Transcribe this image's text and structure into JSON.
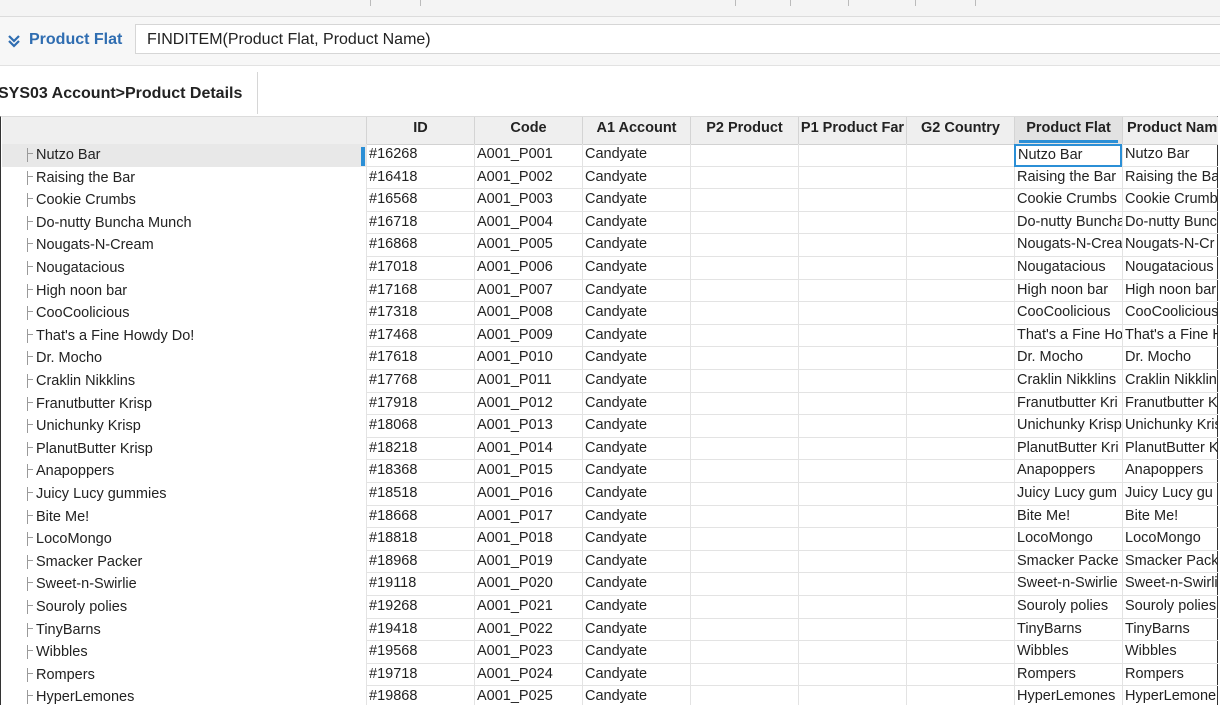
{
  "formula_bar": {
    "name": "Product Flat",
    "formula": "FINDITEM(Product Flat, Product Name)",
    "chevron_icon": "double-chevron-down-icon"
  },
  "view": {
    "title": "SYS03 Account>Product Details"
  },
  "colors": {
    "accent": "#2b8fd6",
    "name_blue": "#2f6db1",
    "header_bg": "#efefef",
    "selected_row": "#e8e8e8"
  },
  "grid": {
    "columns": [
      {
        "key": "id",
        "label": "ID"
      },
      {
        "key": "code",
        "label": "Code"
      },
      {
        "key": "a1",
        "label": "A1 Account"
      },
      {
        "key": "p2",
        "label": "P2 Product"
      },
      {
        "key": "p1",
        "label": "P1 Product Far"
      },
      {
        "key": "g2",
        "label": "G2 Country"
      },
      {
        "key": "flat",
        "label": "Product Flat"
      },
      {
        "key": "name",
        "label": "Product Nam"
      }
    ],
    "active_column": "Product Flat",
    "selected_row": 0,
    "rows": [
      {
        "item": "Nutzo Bar",
        "id": "#16268",
        "code": "A001_P001",
        "a1": "Candyate",
        "p2": "",
        "p1": "",
        "g2": "",
        "flat": "Nutzo Bar",
        "name": "Nutzo Bar"
      },
      {
        "item": "Raising the Bar",
        "id": "#16418",
        "code": "A001_P002",
        "a1": "Candyate",
        "p2": "",
        "p1": "",
        "g2": "",
        "flat": "Raising the Bar",
        "name": "Raising the Ba"
      },
      {
        "item": "Cookie Crumbs",
        "id": "#16568",
        "code": "A001_P003",
        "a1": "Candyate",
        "p2": "",
        "p1": "",
        "g2": "",
        "flat": "Cookie Crumbs",
        "name": "Cookie Crumb"
      },
      {
        "item": "Do-nutty Buncha Munch",
        "id": "#16718",
        "code": "A001_P004",
        "a1": "Candyate",
        "p2": "",
        "p1": "",
        "g2": "",
        "flat": "Do-nutty Buncha",
        "name": "Do-nutty Bunc"
      },
      {
        "item": "Nougats-N-Cream",
        "id": "#16868",
        "code": "A001_P005",
        "a1": "Candyate",
        "p2": "",
        "p1": "",
        "g2": "",
        "flat": "Nougats-N-Crea",
        "name": "Nougats-N-Cr"
      },
      {
        "item": "Nougatacious",
        "id": "#17018",
        "code": "A001_P006",
        "a1": "Candyate",
        "p2": "",
        "p1": "",
        "g2": "",
        "flat": "Nougatacious",
        "name": "Nougatacious"
      },
      {
        "item": "High noon bar",
        "id": "#17168",
        "code": "A001_P007",
        "a1": "Candyate",
        "p2": "",
        "p1": "",
        "g2": "",
        "flat": "High noon bar",
        "name": "High noon bar"
      },
      {
        "item": "CooCoolicious",
        "id": "#17318",
        "code": "A001_P008",
        "a1": "Candyate",
        "p2": "",
        "p1": "",
        "g2": "",
        "flat": "CooCoolicious",
        "name": "CooCoolicious"
      },
      {
        "item": "That's a Fine Howdy Do!",
        "id": "#17468",
        "code": "A001_P009",
        "a1": "Candyate",
        "p2": "",
        "p1": "",
        "g2": "",
        "flat": "That's a Fine Ho",
        "name": "That's a Fine H"
      },
      {
        "item": "Dr. Mocho",
        "id": "#17618",
        "code": "A001_P010",
        "a1": "Candyate",
        "p2": "",
        "p1": "",
        "g2": "",
        "flat": "Dr. Mocho",
        "name": "Dr. Mocho"
      },
      {
        "item": "Craklin Nikklins",
        "id": "#17768",
        "code": "A001_P011",
        "a1": "Candyate",
        "p2": "",
        "p1": "",
        "g2": "",
        "flat": "Craklin Nikklins",
        "name": "Craklin Nikklin"
      },
      {
        "item": "Franutbutter Krisp",
        "id": "#17918",
        "code": "A001_P012",
        "a1": "Candyate",
        "p2": "",
        "p1": "",
        "g2": "",
        "flat": "Franutbutter Kri",
        "name": "Franutbutter K"
      },
      {
        "item": "Unichunky Krisp",
        "id": "#18068",
        "code": "A001_P013",
        "a1": "Candyate",
        "p2": "",
        "p1": "",
        "g2": "",
        "flat": "Unichunky Krisp",
        "name": "Unichunky Kris"
      },
      {
        "item": "PlanutButter Krisp",
        "id": "#18218",
        "code": "A001_P014",
        "a1": "Candyate",
        "p2": "",
        "p1": "",
        "g2": "",
        "flat": "PlanutButter Kri",
        "name": "PlanutButter K"
      },
      {
        "item": "Anapoppers",
        "id": "#18368",
        "code": "A001_P015",
        "a1": "Candyate",
        "p2": "",
        "p1": "",
        "g2": "",
        "flat": "Anapoppers",
        "name": "Anapoppers"
      },
      {
        "item": "Juicy Lucy gummies",
        "id": "#18518",
        "code": "A001_P016",
        "a1": "Candyate",
        "p2": "",
        "p1": "",
        "g2": "",
        "flat": "Juicy Lucy gum",
        "name": "Juicy Lucy gu"
      },
      {
        "item": "Bite Me!",
        "id": "#18668",
        "code": "A001_P017",
        "a1": "Candyate",
        "p2": "",
        "p1": "",
        "g2": "",
        "flat": "Bite Me!",
        "name": "Bite Me!"
      },
      {
        "item": "LocoMongo",
        "id": "#18818",
        "code": "A001_P018",
        "a1": "Candyate",
        "p2": "",
        "p1": "",
        "g2": "",
        "flat": "LocoMongo",
        "name": "LocoMongo"
      },
      {
        "item": "Smacker Packer",
        "id": "#18968",
        "code": "A001_P019",
        "a1": "Candyate",
        "p2": "",
        "p1": "",
        "g2": "",
        "flat": "Smacker Packe",
        "name": "Smacker Pack"
      },
      {
        "item": "Sweet-n-Swirlie",
        "id": "#19118",
        "code": "A001_P020",
        "a1": "Candyate",
        "p2": "",
        "p1": "",
        "g2": "",
        "flat": "Sweet-n-Swirlie",
        "name": "Sweet-n-Swirli"
      },
      {
        "item": "Souroly polies",
        "id": "#19268",
        "code": "A001_P021",
        "a1": "Candyate",
        "p2": "",
        "p1": "",
        "g2": "",
        "flat": "Souroly polies",
        "name": "Souroly polies"
      },
      {
        "item": "TinyBarns",
        "id": "#19418",
        "code": "A001_P022",
        "a1": "Candyate",
        "p2": "",
        "p1": "",
        "g2": "",
        "flat": "TinyBarns",
        "name": "TinyBarns"
      },
      {
        "item": "Wibbles",
        "id": "#19568",
        "code": "A001_P023",
        "a1": "Candyate",
        "p2": "",
        "p1": "",
        "g2": "",
        "flat": "Wibbles",
        "name": "Wibbles"
      },
      {
        "item": "Rompers",
        "id": "#19718",
        "code": "A001_P024",
        "a1": "Candyate",
        "p2": "",
        "p1": "",
        "g2": "",
        "flat": "Rompers",
        "name": "Rompers"
      },
      {
        "item": "HyperLemones",
        "id": "#19868",
        "code": "A001_P025",
        "a1": "Candyate",
        "p2": "",
        "p1": "",
        "g2": "",
        "flat": "HyperLemones",
        "name": "HyperLemone"
      }
    ]
  }
}
